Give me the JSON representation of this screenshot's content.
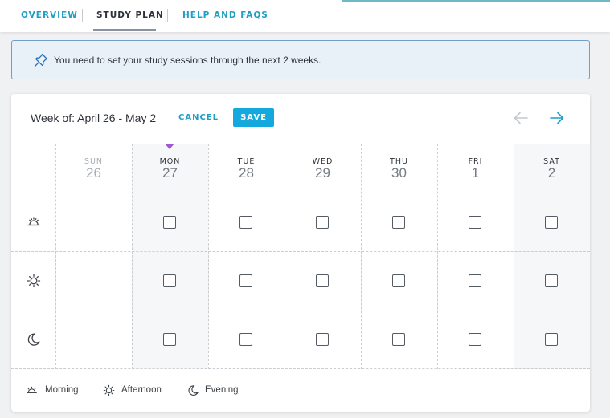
{
  "nav": {
    "tabs": [
      {
        "label": "OVERVIEW"
      },
      {
        "label": "STUDY PLAN"
      },
      {
        "label": "HELP AND FAQS"
      }
    ]
  },
  "banner": {
    "message": "You need to set your study sessions through the next 2 weeks."
  },
  "planner": {
    "week_label": "Week of: April 26 - May 2",
    "cancel_label": "CANCEL",
    "save_label": "SAVE",
    "days": [
      {
        "name": "SUN",
        "date": "26"
      },
      {
        "name": "MON",
        "date": "27"
      },
      {
        "name": "TUE",
        "date": "28"
      },
      {
        "name": "WED",
        "date": "29"
      },
      {
        "name": "THU",
        "date": "30"
      },
      {
        "name": "FRI",
        "date": "1"
      },
      {
        "name": "SAT",
        "date": "2"
      }
    ],
    "rows": [
      {
        "icon": "sunrise-icon"
      },
      {
        "icon": "sun-icon"
      },
      {
        "icon": "moon-icon"
      }
    ]
  },
  "legend": {
    "morning": "Morning",
    "afternoon": "Afternoon",
    "evening": "Evening"
  },
  "colors": {
    "accent": "#14a9de",
    "link": "#1f9fc4",
    "today_marker": "#a355d8",
    "banner_bg": "#e8f1f8",
    "banner_border": "#6f9fc6"
  }
}
